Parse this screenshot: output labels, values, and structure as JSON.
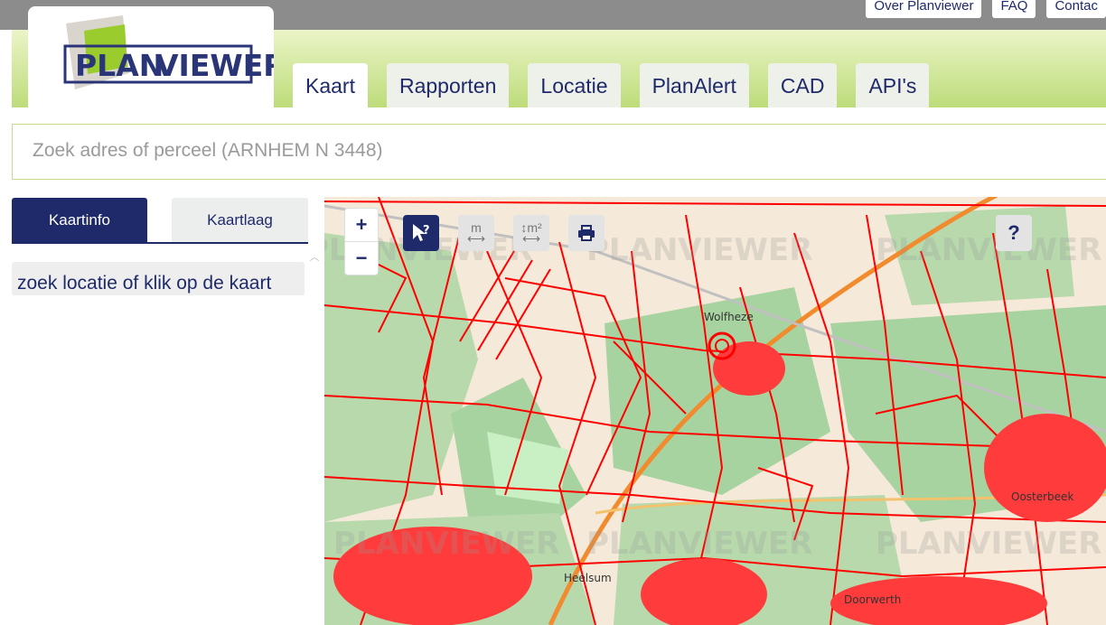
{
  "header": {
    "logo": {
      "part1": "PLAN",
      "part2": "VIEWER"
    },
    "top_links": [
      "Over Planviewer",
      "FAQ",
      "Contac"
    ],
    "tabs": [
      {
        "label": "Kaart",
        "active": true
      },
      {
        "label": "Rapporten",
        "active": false
      },
      {
        "label": "Locatie",
        "active": false
      },
      {
        "label": "PlanAlert",
        "active": false
      },
      {
        "label": "CAD",
        "active": false
      },
      {
        "label": "API's",
        "active": false
      }
    ]
  },
  "search": {
    "placeholder": "Zoek adres of perceel (ARNHEM N 3448)"
  },
  "sidebar": {
    "tabs": [
      {
        "label": "Kaartinfo",
        "active": true
      },
      {
        "label": "Kaartlaag",
        "active": false
      }
    ],
    "info_text": "zoek locatie of klik op de kaart"
  },
  "map": {
    "zoom_in": "+",
    "zoom_out": "−",
    "tools": [
      {
        "icon": "cursor-question-icon",
        "selected": true
      },
      {
        "icon": "measure-distance-icon",
        "label": "m",
        "selected": false
      },
      {
        "icon": "measure-area-icon",
        "label": "m²",
        "selected": false
      },
      {
        "icon": "print-icon",
        "selected": false
      }
    ],
    "help": "?",
    "place_labels": [
      "Wolfheze",
      "Heelsum",
      "Doorwerth",
      "Oosterbeek"
    ],
    "watermark": "PLANVIEWER",
    "colors": {
      "parcel": "#ff0000",
      "forest": "#a7d3a0",
      "field": "#f5e9d9",
      "road": "#f28a2e"
    }
  },
  "colors": {
    "brand": "#1f2a6b",
    "accent_green": "#bddc7a"
  }
}
